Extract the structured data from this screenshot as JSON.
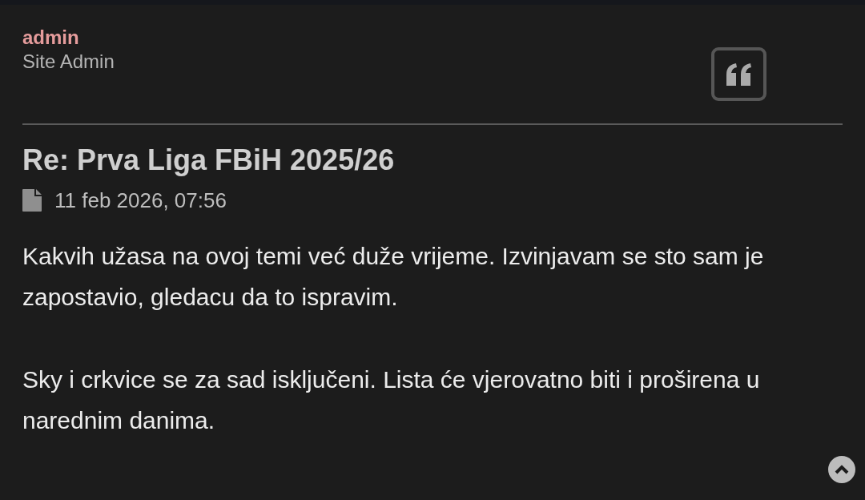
{
  "post": {
    "author": "admin",
    "rank": "Site Admin",
    "title": "Re: Prva Liga FBiH 2025/26",
    "date": "11 feb 2026, 07:56",
    "paragraphs": [
      "Kakvih užasa na ovoj temi već duže vrijeme. Izvinjavam se sto sam je zapostavio, gledacu da to ispravim.",
      "Sky i crkvice se za sad isključeni. Lista će vjerovatno biti i proširena u narednim danima."
    ]
  }
}
